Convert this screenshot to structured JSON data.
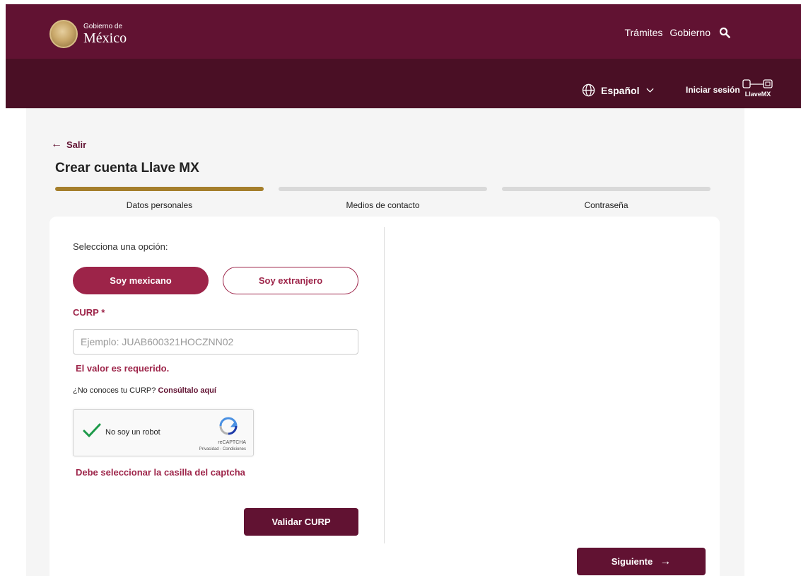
{
  "header": {
    "logo_small": "Gobierno de",
    "logo_big": "México",
    "nav": [
      "Trámites",
      "Gobierno"
    ],
    "language": "Español",
    "login": "Iniciar sesión",
    "llave_logo": "LlaveMX"
  },
  "page": {
    "back_label": "Salir",
    "title": "Crear cuenta Llave MX"
  },
  "steps": [
    {
      "label": "Datos personales",
      "active": true
    },
    {
      "label": "Medios de contacto",
      "active": false
    },
    {
      "label": "Contraseña",
      "active": false
    }
  ],
  "form": {
    "select_label": "Selecciona una opción:",
    "option_mexicano": "Soy mexicano",
    "option_extranjero": "Soy extranjero",
    "selected_option": "Soy mexicano",
    "curp_label": "CURP *",
    "curp_placeholder": "Ejemplo: JUAB600321HOCZNN02",
    "curp_value": "",
    "curp_error": "El valor es requerido.",
    "help_text": "¿No conoces tu CURP?",
    "help_link": "Consúltalo aquí",
    "captcha_text": "No soy un robot",
    "captcha_brand": "reCAPTCHA",
    "captcha_terms": "Privacidad - Condiciones",
    "captcha_error": "Debe seleccionar la casilla del captcha",
    "validate_button": "Validar CURP",
    "next_button": "Siguiente"
  },
  "colors": {
    "header": "#611232",
    "subheader": "#4a0f25",
    "accent": "#9d2449",
    "progress": "#a57f2c"
  }
}
